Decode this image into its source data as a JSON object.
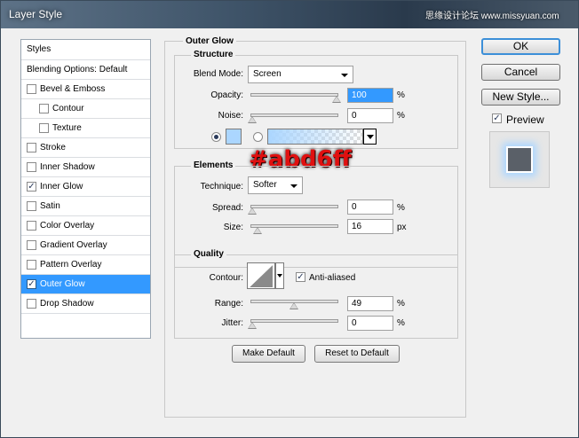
{
  "window": {
    "title": "Layer Style",
    "watermark": "思缘设计论坛 www.missyuan.com"
  },
  "sidebar": {
    "header": "Styles",
    "blending": "Blending Options: Default",
    "items": [
      {
        "label": "Bevel & Emboss",
        "checked": false,
        "indent": false,
        "selected": false
      },
      {
        "label": "Contour",
        "checked": false,
        "indent": true,
        "selected": false
      },
      {
        "label": "Texture",
        "checked": false,
        "indent": true,
        "selected": false
      },
      {
        "label": "Stroke",
        "checked": false,
        "indent": false,
        "selected": false
      },
      {
        "label": "Inner Shadow",
        "checked": false,
        "indent": false,
        "selected": false
      },
      {
        "label": "Inner Glow",
        "checked": true,
        "indent": false,
        "selected": false
      },
      {
        "label": "Satin",
        "checked": false,
        "indent": false,
        "selected": false
      },
      {
        "label": "Color Overlay",
        "checked": false,
        "indent": false,
        "selected": false
      },
      {
        "label": "Gradient Overlay",
        "checked": false,
        "indent": false,
        "selected": false
      },
      {
        "label": "Pattern Overlay",
        "checked": false,
        "indent": false,
        "selected": false
      },
      {
        "label": "Outer Glow",
        "checked": true,
        "indent": false,
        "selected": true
      },
      {
        "label": "Drop Shadow",
        "checked": false,
        "indent": false,
        "selected": false
      }
    ]
  },
  "panel": {
    "title": "Outer Glow",
    "structure": {
      "legend": "Structure",
      "blend_label": "Blend Mode:",
      "blend_value": "Screen",
      "opacity_label": "Opacity:",
      "opacity_value": "100",
      "opacity_level": 1.0,
      "opacity_unit": "%",
      "noise_label": "Noise:",
      "noise_value": "0",
      "noise_level": 0.0,
      "noise_unit": "%",
      "glow_color": "#abd6ff",
      "annotation": "#abd6ff"
    },
    "elements": {
      "legend": "Elements",
      "technique_label": "Technique:",
      "technique_value": "Softer",
      "spread_label": "Spread:",
      "spread_value": "0",
      "spread_level": 0.0,
      "spread_unit": "%",
      "size_label": "Size:",
      "size_value": "16",
      "size_level": 0.06,
      "size_unit": "px"
    },
    "quality": {
      "legend": "Quality",
      "contour_label": "Contour:",
      "antialias_label": "Anti-aliased",
      "antialias_checked": true,
      "range_label": "Range:",
      "range_value": "49",
      "range_level": 0.49,
      "range_unit": "%",
      "jitter_label": "Jitter:",
      "jitter_value": "0",
      "jitter_level": 0.0,
      "jitter_unit": "%"
    },
    "make_default": "Make Default",
    "reset_default": "Reset to Default"
  },
  "right": {
    "ok": "OK",
    "cancel": "Cancel",
    "new_style": "New Style...",
    "preview_label": "Preview",
    "preview_checked": true
  }
}
